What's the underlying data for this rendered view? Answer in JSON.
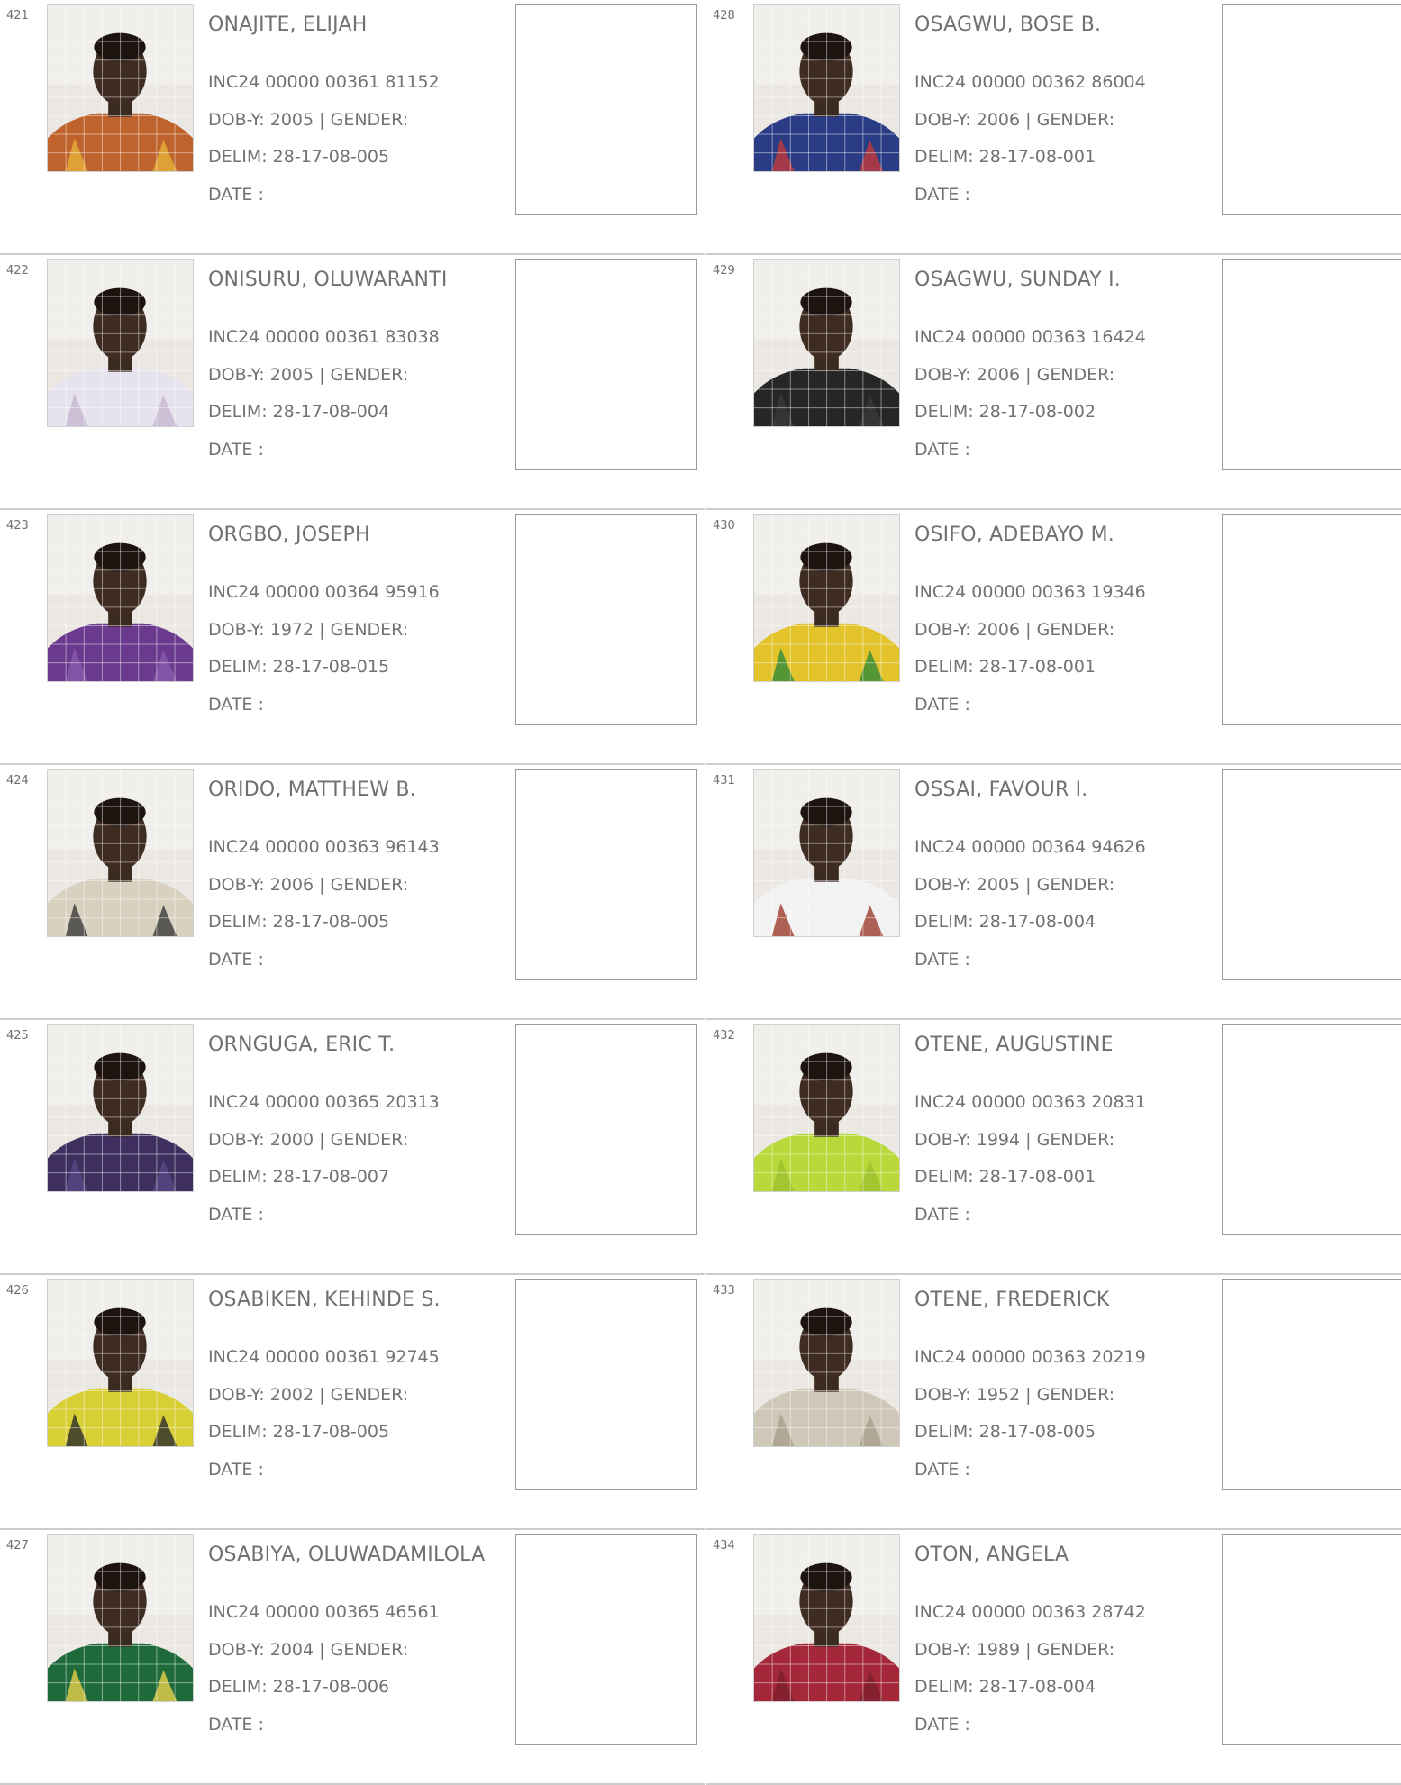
{
  "labels": {
    "dob_prefix": "DOB-Y: ",
    "gender_suffix": " | GENDER:",
    "delim_prefix": "DELIM: ",
    "date_label": "DATE :"
  },
  "columns": [
    [
      {
        "serial": "421",
        "name": "ONAJITE, ELIJAH",
        "inc": "INC24 00000 00361 81152",
        "dob": "2005",
        "delim": "28-17-08-005",
        "shirt": "#c0622c",
        "shirt2": "#e5b13a"
      },
      {
        "serial": "422",
        "name": "ONISURU, OLUWARANTI",
        "inc": "INC24 00000 00361 83038",
        "dob": "2005",
        "delim": "28-17-08-004",
        "shirt": "#e6e3ee",
        "shirt2": "#c7b7cf"
      },
      {
        "serial": "423",
        "name": "ORGBO, JOSEPH",
        "inc": "INC24 00000 00364 95916",
        "dob": "1972",
        "delim": "28-17-08-015",
        "shirt": "#6b3a8e",
        "shirt2": "#8a5aab"
      },
      {
        "serial": "424",
        "name": "ORIDO, MATTHEW B.",
        "inc": "INC24 00000 00363 96143",
        "dob": "2006",
        "delim": "28-17-08-005",
        "shirt": "#d9d1c0",
        "shirt2": "#3a3a3a"
      },
      {
        "serial": "425",
        "name": "ORNGUGA, ERIC T.",
        "inc": "INC24 00000 00365 20313",
        "dob": "2000",
        "delim": "28-17-08-007",
        "shirt": "#3e2f5f",
        "shirt2": "#574785"
      },
      {
        "serial": "426",
        "name": "OSABIKEN, KEHINDE S.",
        "inc": "INC24 00000 00361 92745",
        "dob": "2002",
        "delim": "28-17-08-005",
        "shirt": "#d8cf34",
        "shirt2": "#2b2b2b"
      },
      {
        "serial": "427",
        "name": "OSABIYA, OLUWADAMILOLA",
        "inc": "INC24 00000 00365 46561",
        "dob": "2004",
        "delim": "28-17-08-006",
        "shirt": "#1f6a3a",
        "shirt2": "#e6d04a"
      }
    ],
    [
      {
        "serial": "428",
        "name": "OSAGWU, BOSE B.",
        "inc": "INC24 00000 00362 86004",
        "dob": "2006",
        "delim": "28-17-08-001",
        "shirt": "#2a3c86",
        "shirt2": "#c33a3a"
      },
      {
        "serial": "429",
        "name": "OSAGWU, SUNDAY I.",
        "inc": "INC24 00000 00363 16424",
        "dob": "2006",
        "delim": "28-17-08-002",
        "shirt": "#262626",
        "shirt2": "#3a3a3a"
      },
      {
        "serial": "430",
        "name": "OSIFO, ADEBAYO M.",
        "inc": "INC24 00000 00363 19346",
        "dob": "2006",
        "delim": "28-17-08-001",
        "shirt": "#e3c32a",
        "shirt2": "#2f8a3a"
      },
      {
        "serial": "431",
        "name": "OSSAI, FAVOUR I.",
        "inc": "INC24 00000 00364 94626",
        "dob": "2005",
        "delim": "28-17-08-004",
        "shirt": "#f2f2f2",
        "shirt2": "#9b3b2a"
      },
      {
        "serial": "432",
        "name": "OTENE, AUGUSTINE",
        "inc": "INC24 00000 00363 20831",
        "dob": "1994",
        "delim": "28-17-08-001",
        "shirt": "#b9d83a",
        "shirt2": "#9cc02e"
      },
      {
        "serial": "433",
        "name": "OTENE, FREDERICK",
        "inc": "INC24 00000 00363 20219",
        "dob": "1952",
        "delim": "28-17-08-005",
        "shirt": "#cfc8b8",
        "shirt2": "#a89f8d"
      },
      {
        "serial": "434",
        "name": "OTON, ANGELA",
        "inc": "INC24 00000 00363 28742",
        "dob": "1989",
        "delim": "28-17-08-004",
        "shirt": "#a5283a",
        "shirt2": "#7d1e2c"
      }
    ]
  ]
}
